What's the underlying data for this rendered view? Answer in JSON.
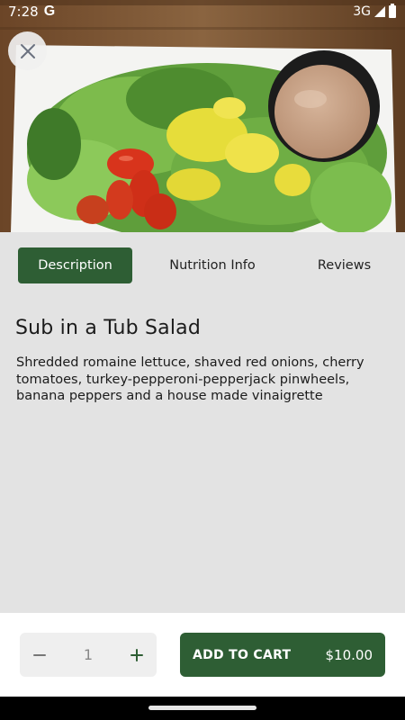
{
  "status_bar": {
    "time": "7:28",
    "g_label": "G",
    "network": "3G"
  },
  "hero": {
    "image_desc_icon": "salad-photo",
    "close_icon": "close-icon"
  },
  "tabs": [
    {
      "label": "Description",
      "active": true
    },
    {
      "label": "Nutrition Info",
      "active": false
    },
    {
      "label": "Reviews",
      "active": false
    }
  ],
  "item": {
    "title": "Sub in a Tub Salad",
    "description": "Shredded romaine lettuce, shaved red onions, cherry tomatoes, turkey-pepperoni-pepperjack pinwheels, banana peppers and a house made vinaigrette"
  },
  "cart": {
    "quantity": "1",
    "add_label": "ADD TO CART",
    "price": "$10.00"
  },
  "colors": {
    "accent": "#2e5e34",
    "background": "#e3e3e3"
  }
}
